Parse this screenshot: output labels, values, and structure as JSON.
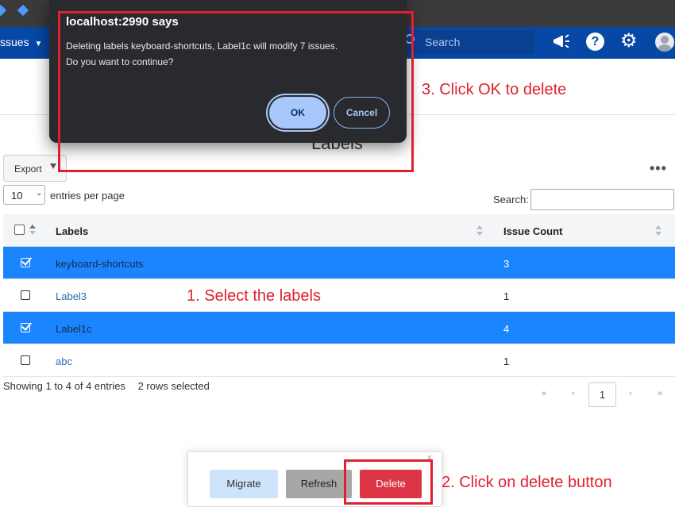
{
  "header": {
    "issues_menu": "ssues",
    "search_placeholder": "Search",
    "help_glyph": "?",
    "settings_glyph": "⚙"
  },
  "page": {
    "title": "Labels",
    "export_label": "Export",
    "entries_value": "10",
    "entries_label": "entries per page",
    "search_label": "Search:"
  },
  "table": {
    "columns": [
      "Labels",
      "Issue Count"
    ],
    "rows": [
      {
        "label": "keyboard-shortcuts",
        "count": "3",
        "selected": true
      },
      {
        "label": "Label3",
        "count": "1",
        "selected": false
      },
      {
        "label": "Label1c",
        "count": "4",
        "selected": true
      },
      {
        "label": "abc",
        "count": "1",
        "selected": false
      }
    ],
    "info": "Showing 1 to 4 of 4 entries",
    "selection_info": "2 rows selected"
  },
  "pagination": {
    "first": "«",
    "prev": "‹",
    "current": "1",
    "next": "›",
    "last": "»"
  },
  "actions": {
    "migrate": "Migrate",
    "refresh": "Refresh",
    "delete": "Delete",
    "close": "×"
  },
  "dialog": {
    "title": "localhost:2990 says",
    "message_line1": "Deleting labels keyboard-shortcuts, Label1c will modify 7 issues.",
    "message_line2": "Do you want to continue?",
    "ok": "OK",
    "cancel": "Cancel"
  },
  "annotations": {
    "step1": "1. Select the labels",
    "step2": "2. Click on delete button",
    "step3": "3. Click OK to delete"
  },
  "colors": {
    "header": "#0747a6",
    "selected_row": "#1a85ff",
    "delete_button": "#dc3545",
    "annotation": "#e0202f",
    "dialog": "#292a2d"
  }
}
